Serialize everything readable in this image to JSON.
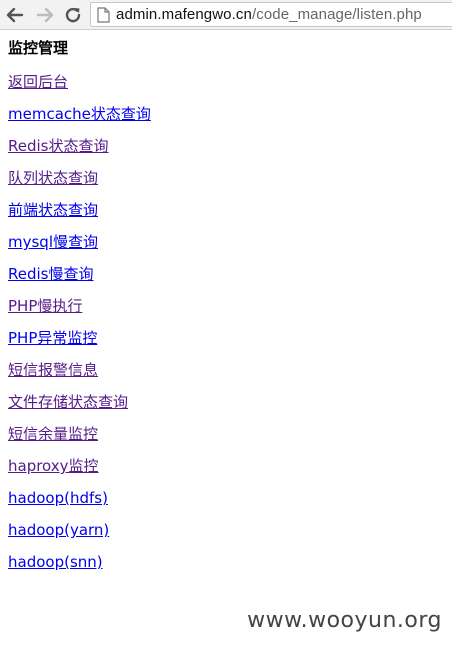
{
  "browser": {
    "back_icon": "arrow-left-icon",
    "forward_icon": "arrow-right-icon",
    "reload_icon": "reload-icon",
    "url_host": "admin.mafengwo.cn",
    "url_path": "/code_manage/listen.php"
  },
  "page": {
    "title": "监控管理",
    "links": [
      {
        "label": "返回后台",
        "state": "visited"
      },
      {
        "label": "memcache状态查询",
        "state": "unvisited"
      },
      {
        "label": "Redis状态查询",
        "state": "visited"
      },
      {
        "label": "队列状态查询",
        "state": "visited"
      },
      {
        "label": "前端状态查询",
        "state": "unvisited"
      },
      {
        "label": "mysql慢查询",
        "state": "unvisited"
      },
      {
        "label": "Redis慢查询",
        "state": "unvisited"
      },
      {
        "label": "PHP慢执行",
        "state": "visited"
      },
      {
        "label": "PHP异常监控",
        "state": "unvisited"
      },
      {
        "label": "短信报警信息",
        "state": "visited"
      },
      {
        "label": "文件存储状态查询",
        "state": "visited"
      },
      {
        "label": "短信余量监控",
        "state": "visited"
      },
      {
        "label": "haproxy监控",
        "state": "visited"
      },
      {
        "label": "hadoop(hdfs)",
        "state": "unvisited"
      },
      {
        "label": "hadoop(yarn)",
        "state": "unvisited"
      },
      {
        "label": "hadoop(snn)",
        "state": "unvisited"
      }
    ],
    "link_colors": {
      "unvisited": "#0000ee",
      "visited": "#551a8b"
    }
  },
  "watermark": "www.wooyun.org"
}
